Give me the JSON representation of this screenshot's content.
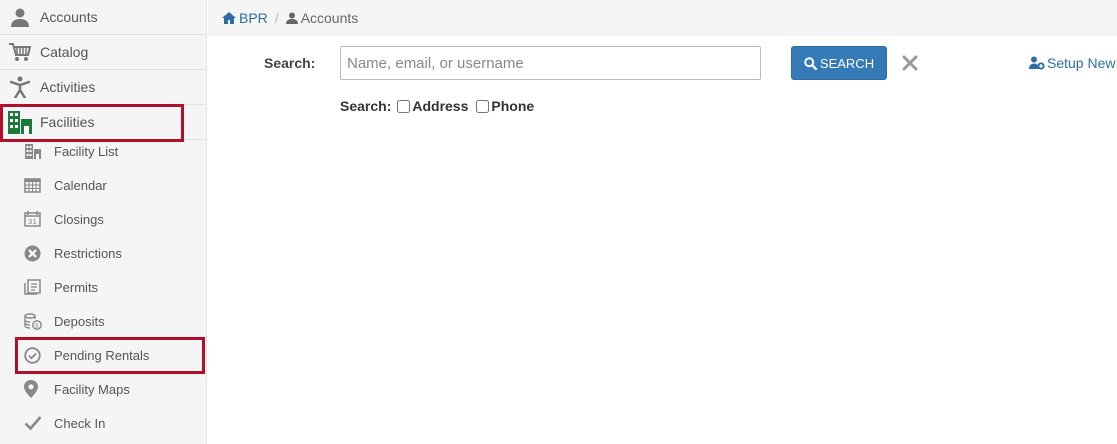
{
  "sidebar": {
    "top_items": [
      {
        "label": "Accounts",
        "icon": "user-icon"
      },
      {
        "label": "Catalog",
        "icon": "cart-icon"
      },
      {
        "label": "Activities",
        "icon": "person-icon"
      },
      {
        "label": "Facilities",
        "icon": "buildings-icon",
        "active": true
      }
    ],
    "sub_items": [
      {
        "label": "Facility List",
        "icon": "building-icon"
      },
      {
        "label": "Calendar",
        "icon": "calendar-icon"
      },
      {
        "label": "Closings",
        "icon": "calendar-31-icon"
      },
      {
        "label": "Restrictions",
        "icon": "circle-x-icon"
      },
      {
        "label": "Permits",
        "icon": "permits-icon"
      },
      {
        "label": "Deposits",
        "icon": "coins-icon"
      },
      {
        "label": "Pending Rentals",
        "icon": "circle-check-icon"
      },
      {
        "label": "Facility Maps",
        "icon": "map-pin-icon"
      },
      {
        "label": "Check In",
        "icon": "check-icon"
      }
    ]
  },
  "breadcrumb": {
    "home": "BPR",
    "current": "Accounts"
  },
  "search": {
    "label": "Search:",
    "placeholder": "Name, email, or username",
    "button": "SEARCH",
    "options_label": "Search:",
    "options": [
      "Address",
      "Phone"
    ]
  },
  "setup_link": "Setup New",
  "colors": {
    "accent": "#337ab7",
    "highlight": "#b0102c",
    "active_icon": "#1b7a3a"
  }
}
